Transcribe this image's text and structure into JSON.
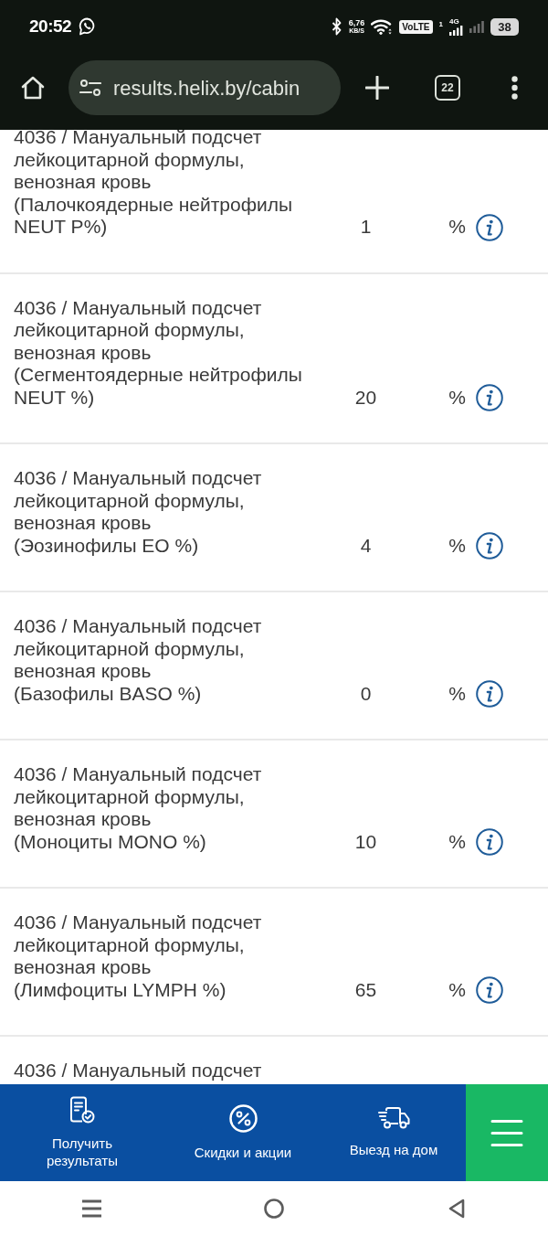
{
  "status_bar": {
    "time": "20:52",
    "speed_value": "6,76",
    "speed_unit": "KB/S",
    "volte": "VoLTE",
    "sim": "1",
    "network": "4G",
    "battery": "38"
  },
  "browser": {
    "url": "results.helix.by/cabin",
    "tab_count": "22"
  },
  "results": [
    {
      "test": "4036 / Мануальный подсчет лейкоцитарной формулы, венозная кровь",
      "parameter": "(Палочкоядерные нейтрофилы NEUT P%)",
      "value": "1",
      "unit": "%"
    },
    {
      "test": "4036 / Мануальный подсчет лейкоцитарной формулы, венозная кровь",
      "parameter": "(Сегментоядерные нейтрофилы NEUT %)",
      "value": "20",
      "unit": "%"
    },
    {
      "test": "4036 / Мануальный подсчет лейкоцитарной формулы, венозная кровь",
      "parameter": "(Эозинофилы EO %)",
      "value": "4",
      "unit": "%"
    },
    {
      "test": "4036 / Мануальный подсчет лейкоцитарной формулы, венозная кровь",
      "parameter": "(Базофилы BASO %)",
      "value": "0",
      "unit": "%"
    },
    {
      "test": "4036 / Мануальный подсчет лейкоцитарной формулы, венозная кровь",
      "parameter": "(Моноциты MONO %)",
      "value": "10",
      "unit": "%"
    },
    {
      "test": "4036 / Мануальный подсчет лейкоцитарной формулы, венозная кровь",
      "parameter": "(Лимфоциты LYMPH %)",
      "value": "65",
      "unit": "%"
    },
    {
      "test": "4036 / Мануальный подсчет"
    }
  ],
  "bottom_nav": [
    {
      "kind": "results",
      "label": "Получить результаты"
    },
    {
      "kind": "discounts",
      "label": "Скидки и акции"
    },
    {
      "kind": "home_visit",
      "label": "Выезд на дом"
    }
  ]
}
